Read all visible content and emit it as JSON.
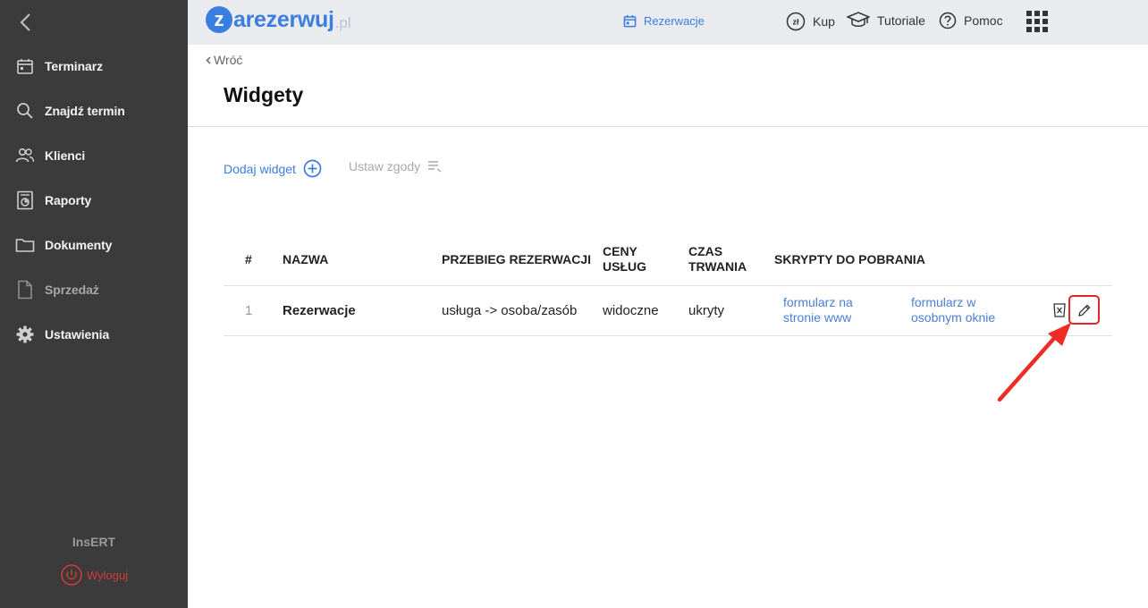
{
  "sidebar": {
    "items": [
      {
        "label": "Terminarz",
        "icon": "calendar-icon"
      },
      {
        "label": "Znajdź termin",
        "icon": "search-icon"
      },
      {
        "label": "Klienci",
        "icon": "users-icon"
      },
      {
        "label": "Raporty",
        "icon": "report-icon"
      },
      {
        "label": "Dokumenty",
        "icon": "folder-icon"
      },
      {
        "label": "Sprzedaż",
        "icon": "document-icon"
      },
      {
        "label": "Ustawienia",
        "icon": "gear-icon"
      }
    ],
    "brand": "InsERT",
    "logout": "Wyloguj"
  },
  "topbar": {
    "logo": {
      "initial": "z",
      "rest": "arezerwuj",
      "tld": ".pl"
    },
    "links": {
      "reservations": "Rezerwacje",
      "buy": "Kup",
      "tutorials": "Tutoriale",
      "help": "Pomoc"
    }
  },
  "page": {
    "back": "Wróć",
    "title": "Widgety",
    "actions": {
      "add_widget": "Dodaj widget",
      "set_consents": "Ustaw zgody"
    }
  },
  "table": {
    "headers": {
      "num": "#",
      "name": "NAZWA",
      "flow": "PRZEBIEG REZERWACJI",
      "prices_line1": "CENY",
      "prices_line2": "USŁUG",
      "duration_line1": "CZAS",
      "duration_line2": "TRWANIA",
      "scripts": "SKRYPTY DO POBRANIA"
    },
    "rows": [
      {
        "num": "1",
        "name": "Rezerwacje",
        "flow": "usługa -> osoba/zasób",
        "prices": "widoczne",
        "duration": "ukryty",
        "script_www_line1": "formularz na",
        "script_www_line2": "stronie www",
        "script_window_line1": "formularz w",
        "script_window_line2": "osobnym oknie"
      }
    ]
  },
  "colors": {
    "accent": "#3a7fe0",
    "sidebar_bg": "#3b3b3b",
    "topbar_bg": "#e9ebee",
    "danger": "#e3252a"
  }
}
